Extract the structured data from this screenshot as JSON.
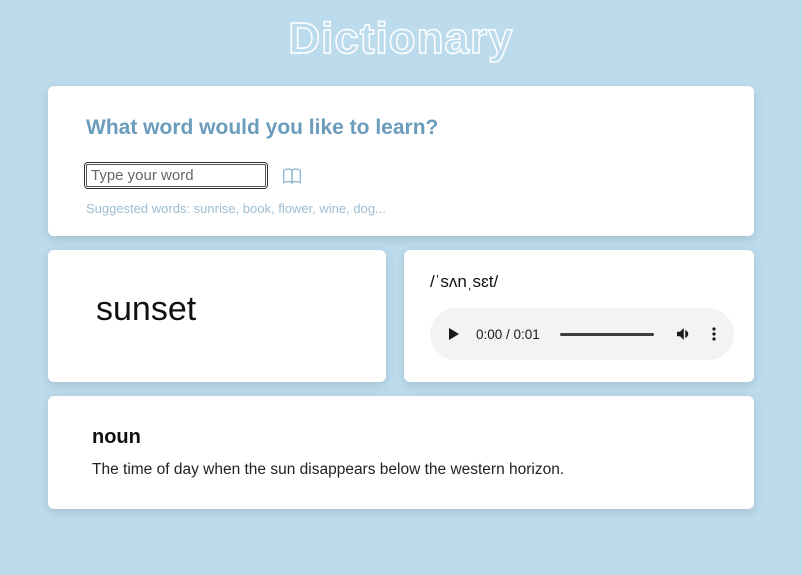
{
  "app_title": "Dictionary",
  "search": {
    "prompt": "What word would you like to learn?",
    "placeholder": "Type your word",
    "suggested": "Suggested words: sunrise, book, flower, wine, dog..."
  },
  "result": {
    "word": "sunset",
    "phonetic": "/ˈsʌnˌsɛt/",
    "audio_time": "0:00 / 0:01",
    "part_of_speech": "noun",
    "definition": "The time of day when the sun disappears below the western horizon."
  }
}
